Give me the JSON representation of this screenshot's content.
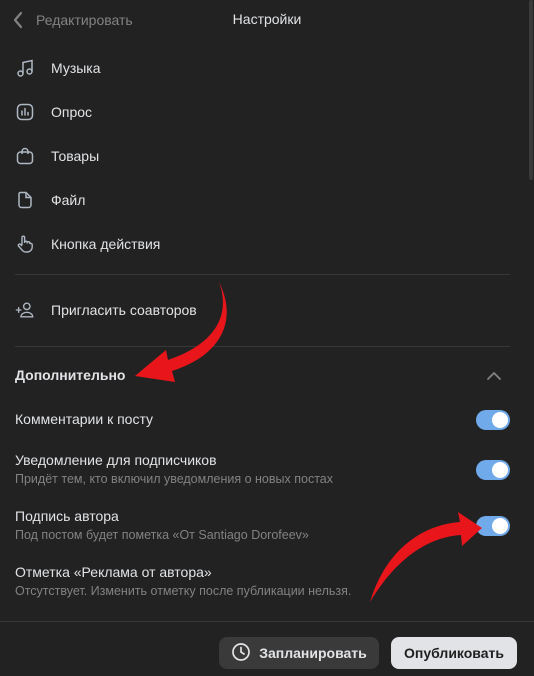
{
  "header": {
    "back_label": "Редактировать",
    "title": "Настройки"
  },
  "attachments": [
    {
      "label": "Музыка",
      "icon": "music-icon"
    },
    {
      "label": "Опрос",
      "icon": "poll-icon"
    },
    {
      "label": "Товары",
      "icon": "shopping-bag-icon"
    },
    {
      "label": "Файл",
      "icon": "file-icon"
    },
    {
      "label": "Кнопка действия",
      "icon": "hand-pointer-icon"
    }
  ],
  "invite": {
    "label": "Пригласить соавторов",
    "icon": "add-user-icon"
  },
  "additional": {
    "title": "Дополнительно",
    "options": [
      {
        "title": "Комментарии к посту",
        "subtitle": "",
        "enabled": true
      },
      {
        "title": "Уведомление для подписчиков",
        "subtitle": "Придёт тем, кто включил уведомления о новых постах",
        "enabled": true
      },
      {
        "title": "Подпись автора",
        "subtitle": "Под постом будет пометка «От Santiago Dorofeev»",
        "enabled": true
      },
      {
        "title": "Отметка «Реклама от автора»",
        "subtitle": "Отсутствует. Изменить отметку после публикации нельзя."
      }
    ]
  },
  "footer": {
    "schedule_label": "Запланировать",
    "publish_label": "Опубликовать"
  },
  "colors": {
    "background": "#222222",
    "toggle_on": "#71aaeb",
    "annotation_arrow": "#e8161b"
  }
}
